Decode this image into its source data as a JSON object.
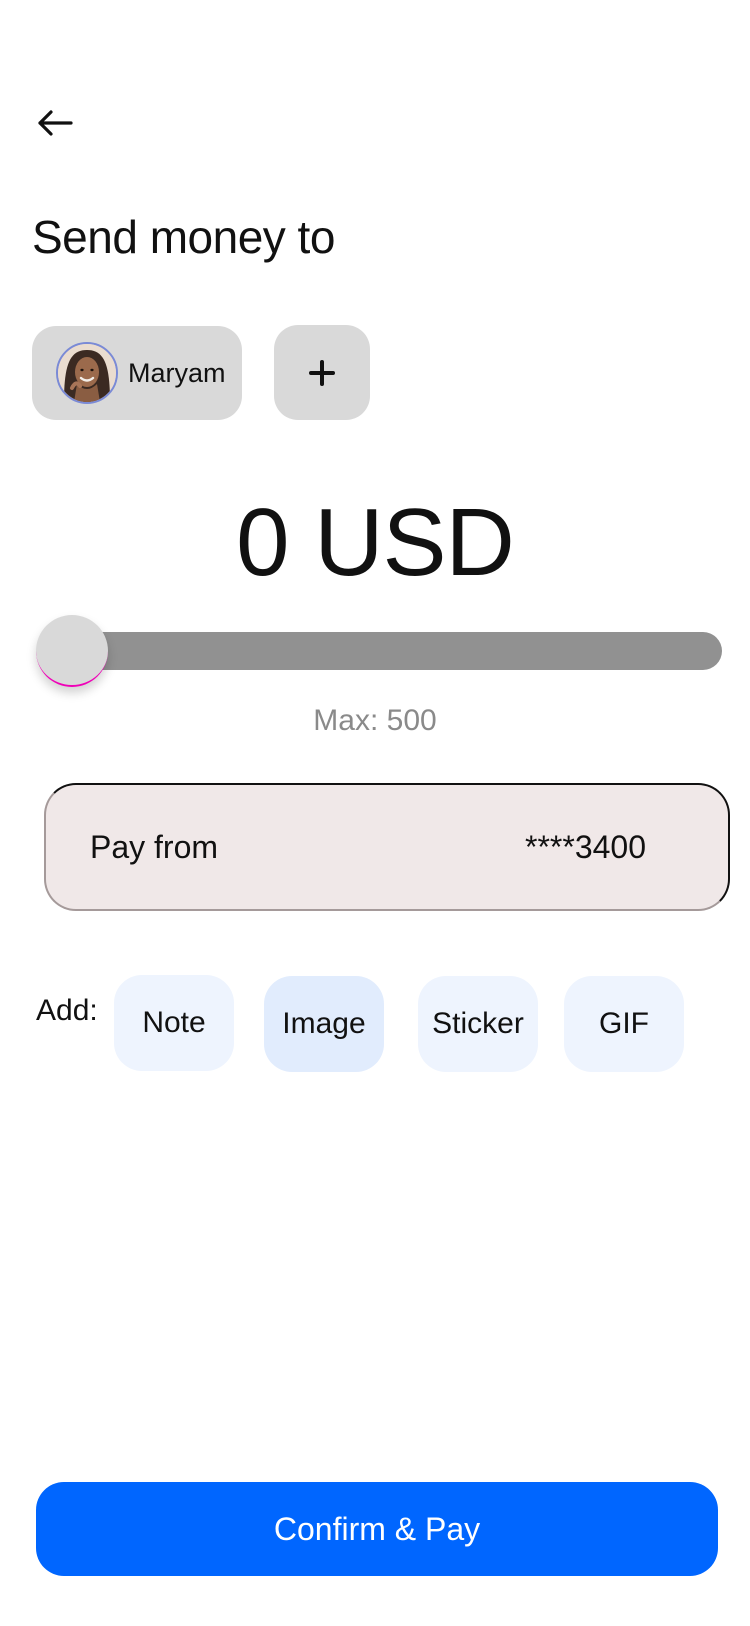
{
  "header": {
    "back_icon": "arrow-left-icon",
    "title": "Send money to"
  },
  "recipients": {
    "selected": {
      "name": "Maryam",
      "avatar_icon": "user-avatar"
    },
    "add_icon": "plus-icon"
  },
  "amount": {
    "display": "0 USD",
    "value": 0,
    "currency": "USD"
  },
  "slider": {
    "value": 0,
    "max": 500,
    "max_label": "Max: 500",
    "fill_fraction": 0
  },
  "payment": {
    "label": "Pay from",
    "card": "****3400"
  },
  "attachments": {
    "label": "Add:",
    "options": [
      "Note",
      "Image",
      "Sticker",
      "GIF"
    ],
    "selected": "Image"
  },
  "actions": {
    "confirm_label": "Confirm & Pay"
  },
  "colors": {
    "primary": "#0066ff",
    "chip_bg": "#eef4fe",
    "chip_selected_bg": "#e1ecfd",
    "neutral_chip": "#d9d9d9",
    "slider_track": "#919191",
    "slider_accent": "#f000b8",
    "card_bg": "#f0e8e8"
  }
}
